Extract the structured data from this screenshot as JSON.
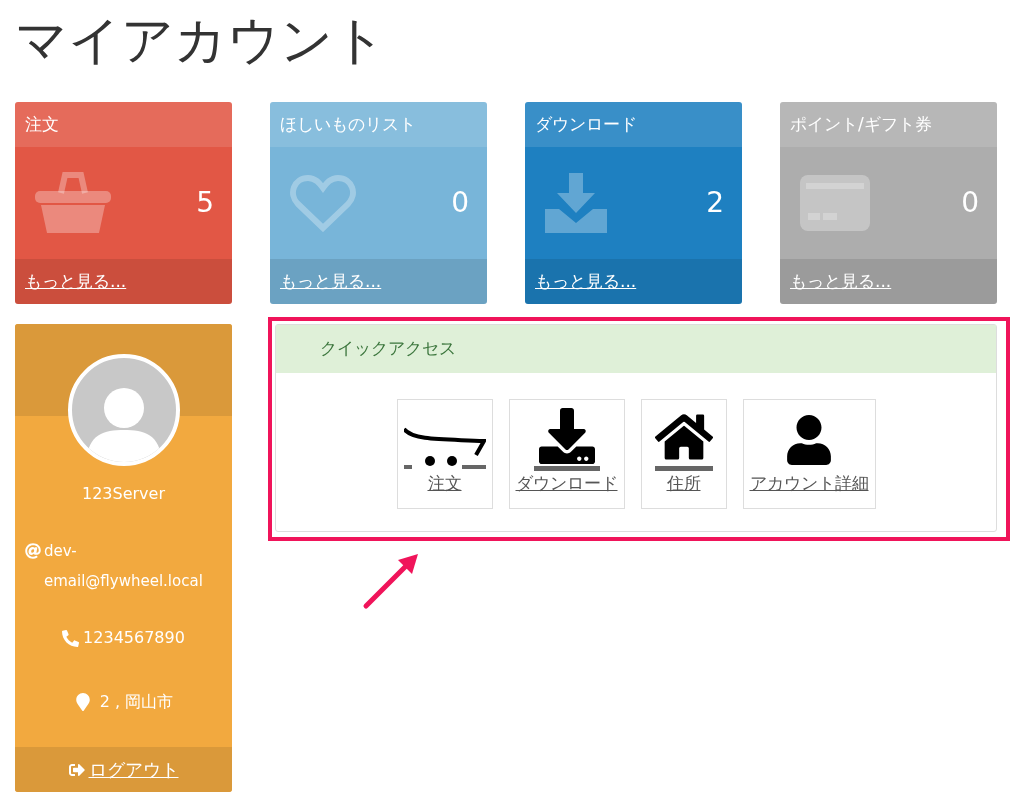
{
  "page_title": "マイアカウント",
  "summary_cards": [
    {
      "kind": "orders",
      "title": "注文",
      "count": "5",
      "link": "もっと見る...",
      "color": "#e25745"
    },
    {
      "kind": "wishlist",
      "title": "ほしいものリスト",
      "count": "0",
      "link": "もっと見る...",
      "color": "#78b5d9"
    },
    {
      "kind": "downloads",
      "title": "ダウンロード",
      "count": "2",
      "link": "もっと見る...",
      "color": "#1e80c1"
    },
    {
      "kind": "points",
      "title": "ポイント/ギフト券",
      "count": "0",
      "link": "もっと見る...",
      "color": "#adadad"
    }
  ],
  "profile": {
    "name": "123Server",
    "email": "dev-email@flywheel.local",
    "phone": "1234567890",
    "address": "2 , 岡山市",
    "logout": "ログアウト"
  },
  "quick_access": {
    "title": "クイックアクセス",
    "items": [
      {
        "kind": "orders",
        "label": "注文"
      },
      {
        "kind": "downloads",
        "label": "ダウンロード"
      },
      {
        "kind": "address",
        "label": "住所"
      },
      {
        "kind": "account",
        "label": "アカウント詳細"
      }
    ]
  }
}
